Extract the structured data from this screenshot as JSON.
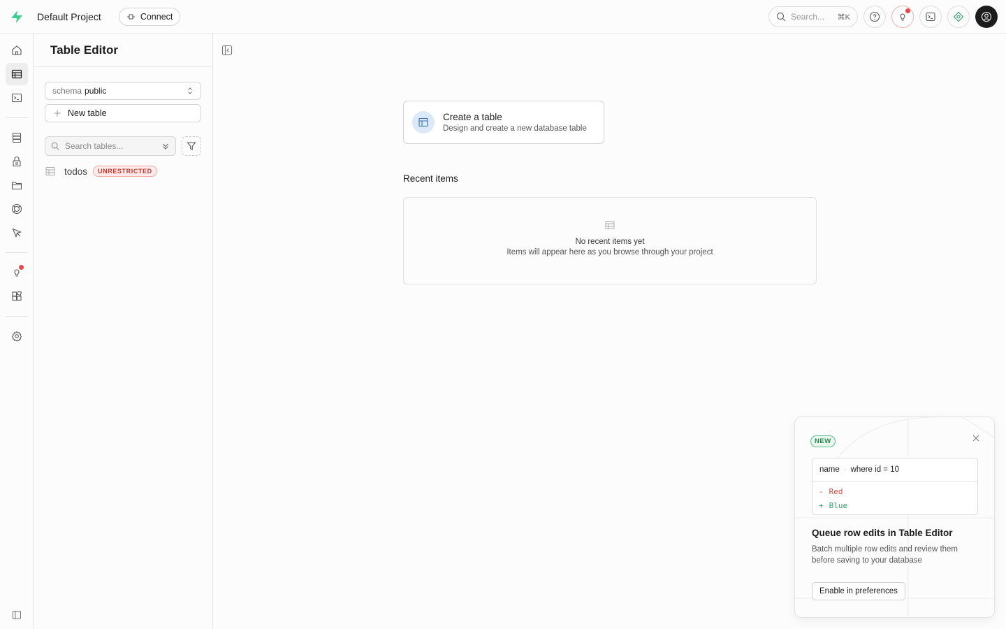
{
  "topbar": {
    "project_name": "Default Project",
    "connect_label": "Connect",
    "search_placeholder": "Search...",
    "search_shortcut": "⌘K"
  },
  "rail": {
    "items": [
      {
        "icon": "home-icon"
      },
      {
        "icon": "table-editor-icon",
        "active": true
      },
      {
        "icon": "sql-editor-icon"
      },
      {
        "icon": "database-icon"
      },
      {
        "icon": "auth-lock-icon"
      },
      {
        "icon": "storage-folder-icon"
      },
      {
        "icon": "realtime-icon"
      },
      {
        "icon": "edge-functions-icon"
      },
      {
        "icon": "advisors-lightbulb-icon"
      },
      {
        "icon": "integrations-icon"
      },
      {
        "icon": "settings-gear-icon"
      }
    ]
  },
  "sidebar": {
    "title": "Table Editor",
    "schema_label": "schema",
    "schema_value": "public",
    "new_table_label": "New table",
    "search_placeholder": "Search tables...",
    "tables": [
      {
        "name": "todos",
        "badge": "UNRESTRICTED"
      }
    ]
  },
  "main": {
    "create_title": "Create a table",
    "create_subtitle": "Design and create a new database table",
    "recent_title": "Recent items",
    "recent_empty_title": "No recent items yet",
    "recent_empty_subtitle": "Items will appear here as you browse through your project"
  },
  "promo": {
    "badge": "NEW",
    "diff_column": "name",
    "diff_filter": "where id = 10",
    "diff_removed_sign": "-",
    "diff_removed": "Red",
    "diff_added_sign": "+",
    "diff_added": "Blue",
    "title": "Queue row edits in Table Editor",
    "description": "Batch multiple row edits and review them before saving to your database",
    "button_label": "Enable in preferences"
  },
  "colors": {
    "brand": "#3ecf8e",
    "danger": "#e5484d",
    "success": "#2f9e66"
  }
}
